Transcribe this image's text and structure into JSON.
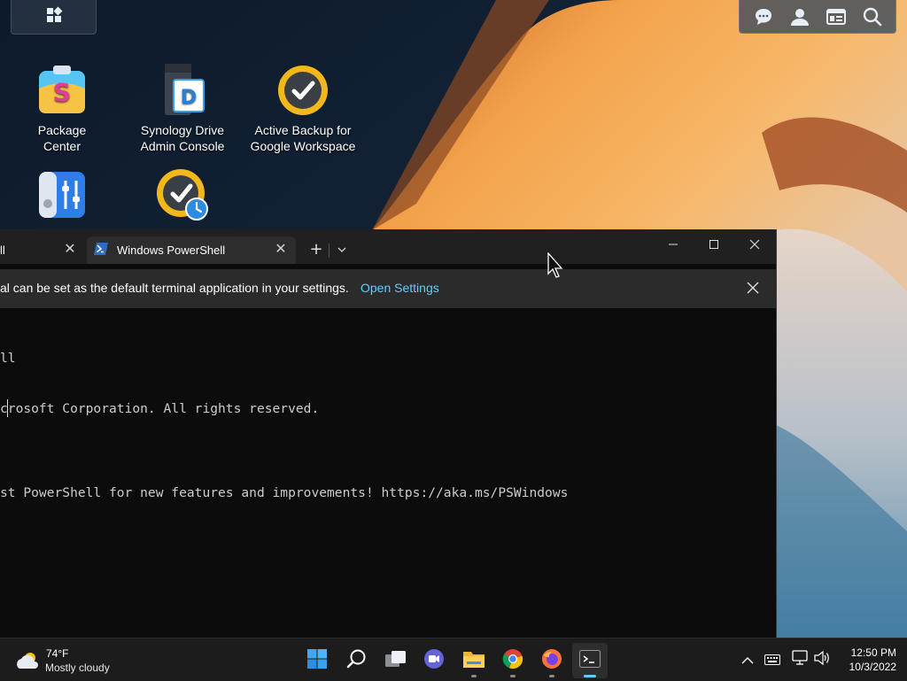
{
  "colors": {
    "terminal_bg": "#0c0c0c",
    "tabbar_bg": "#202020",
    "active_tab_bg": "#2d2d2d",
    "infobar_bg": "#2b2b2b",
    "link": "#60cdff",
    "taskbar_bg": "#1c1c1c",
    "accent": "#60cdff"
  },
  "dsm": {
    "main_menu_icon": "grid-icon",
    "tray": [
      "chat-icon",
      "user-icon",
      "widget-icon",
      "search-icon"
    ]
  },
  "desktop": {
    "icons": [
      {
        "label": "Package\nCenter",
        "icon": "package-center-icon"
      },
      {
        "label": "Synology Drive\nAdmin Console",
        "icon": "synology-drive-icon"
      },
      {
        "label": "Active Backup for\nGoogle Workspace",
        "icon": "active-backup-icon"
      },
      {
        "label": "",
        "icon": "control-panel-icon"
      },
      {
        "label": "",
        "icon": "snapshot-backup-icon"
      }
    ]
  },
  "terminal": {
    "tabs": [
      {
        "title": "ll",
        "active": false
      },
      {
        "title": "Windows PowerShell",
        "active": true
      }
    ],
    "new_tab": "+",
    "infobar": {
      "message": "al can be set as the default terminal application in your settings.",
      "link": "Open Settings"
    },
    "console_lines": [
      "ll",
      "crosoft Corporation. All rights reserved.",
      "",
      "st PowerShell for new features and improvements! https://aka.ms/PSWindows"
    ]
  },
  "taskbar": {
    "weather": {
      "temp": "74°F",
      "condition": "Mostly cloudy",
      "icon": "cloudy-icon"
    },
    "apps": [
      "start-icon",
      "search-icon",
      "task-view-icon",
      "teams-chat-icon",
      "file-explorer-icon",
      "chrome-icon",
      "firefox-icon",
      "terminal-icon"
    ],
    "clock": {
      "time": "12:50 PM",
      "date": "10/3/2022"
    }
  }
}
